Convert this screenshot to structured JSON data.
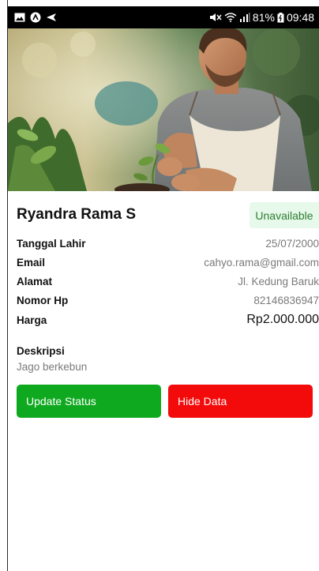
{
  "status_bar": {
    "battery": "81%",
    "time": "09:48",
    "left_icons": [
      "image-icon",
      "app-circle-icon",
      "send-icon"
    ],
    "right_icons": [
      "mute-vibrate-icon",
      "wifi-icon",
      "signal-icon",
      "battery-icon"
    ]
  },
  "hero": {
    "image": "man-gardening-photo"
  },
  "profile": {
    "name": "Ryandra Rama S",
    "status": "Unavailable"
  },
  "details": [
    {
      "label": "Tanggal Lahir",
      "value": "25/07/2000"
    },
    {
      "label": "Email",
      "value": "cahyo.rama@gmail.com"
    },
    {
      "label": "Alamat",
      "value": "Jl. Kedung Baruk"
    },
    {
      "label": "Nomor Hp",
      "value": "82146836947"
    },
    {
      "label": "Harga",
      "value": "Rp2.000.000"
    }
  ],
  "description": {
    "label": "Deskripsi",
    "value": "Jago berkebun"
  },
  "actions": {
    "update_label": "Update Status",
    "hide_label": "Hide Data"
  },
  "colors": {
    "status_bar": "#000000",
    "badge_bg": "#e6f9ea",
    "badge_text": "#2e7d32",
    "update_button": "#0fa91f",
    "hide_button": "#f30a0a"
  }
}
